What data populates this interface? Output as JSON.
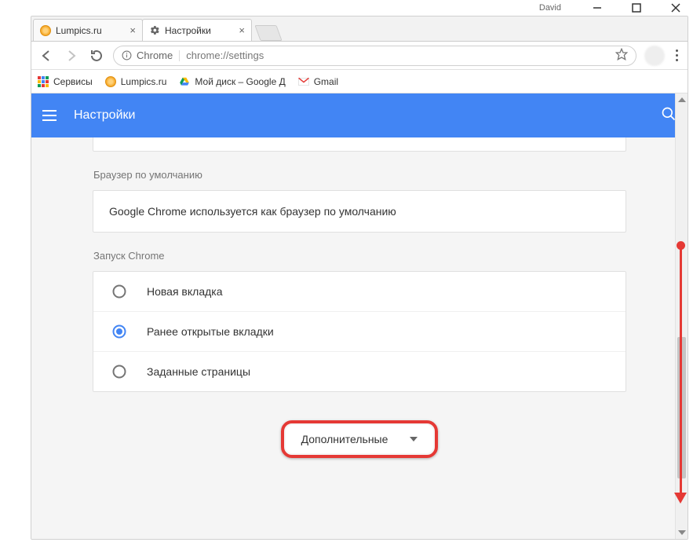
{
  "window": {
    "username": "David"
  },
  "tabs": [
    {
      "title": "Lumpics.ru",
      "active": false
    },
    {
      "title": "Настройки",
      "active": true
    }
  ],
  "address": {
    "app_chip": "Chrome",
    "url": "chrome://settings"
  },
  "bookmarks": [
    {
      "label": "Сервисы",
      "icon": "apps"
    },
    {
      "label": "Lumpics.ru",
      "icon": "orange"
    },
    {
      "label": "Мой диск – Google Д",
      "icon": "drive"
    },
    {
      "label": "Gmail",
      "icon": "gmail"
    }
  ],
  "header": {
    "title": "Настройки"
  },
  "sections": {
    "default_browser": {
      "title": "Браузер по умолчанию",
      "text": "Google Chrome используется как браузер по умолчанию"
    },
    "startup": {
      "title": "Запуск Chrome",
      "options": [
        {
          "label": "Новая вкладка",
          "selected": false
        },
        {
          "label": "Ранее открытые вкладки",
          "selected": true
        },
        {
          "label": "Заданные страницы",
          "selected": false
        }
      ]
    }
  },
  "advanced_button": "Дополнительные",
  "colors": {
    "primary": "#4285f4",
    "highlight": "#e53935"
  }
}
